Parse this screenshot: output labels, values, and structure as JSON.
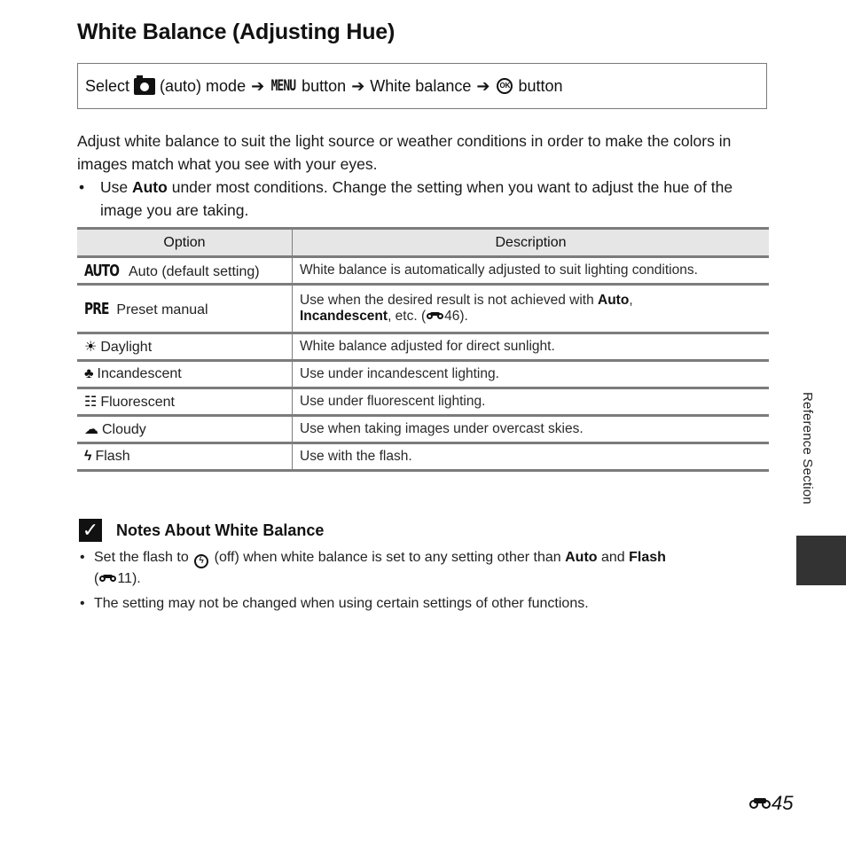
{
  "page": {
    "title": "White Balance (Adjusting Hue)",
    "path": {
      "select": "Select",
      "camera_icon": "camera-icon",
      "mode": "(auto) mode",
      "arrow": "➔",
      "menu": "MENU",
      "button": "button",
      "white_balance": "White balance",
      "ok": "OK",
      "button2": "button"
    },
    "intro": {
      "paragraph": "Adjust white balance to suit the light source or weather conditions in order to make the colors in images match what you see with your eyes.",
      "bullet_pre": "Use ",
      "bullet_bold": "Auto",
      "bullet_post": " under most conditions. Change the setting when you want to adjust the hue of the image you are taking."
    },
    "table": {
      "headers": [
        "Option",
        "Description"
      ],
      "rows": [
        {
          "icon": "AUTO",
          "icon_name": "auto-icon",
          "option": "Auto (default setting)",
          "description": "White balance is automatically adjusted to suit lighting conditions."
        },
        {
          "icon": "PRE",
          "icon_name": "preset-icon",
          "option": "Preset manual",
          "desc_pre": "Use when the desired result is not achieved with ",
          "desc_b1": "Auto",
          "desc_mid": ", ",
          "desc_b2": "Incandescent",
          "desc_post": ", etc. (",
          "desc_ref": "46",
          "desc_end": ")."
        },
        {
          "icon": "☀",
          "icon_name": "daylight-icon",
          "option": "Daylight",
          "description": "White balance adjusted for direct sunlight."
        },
        {
          "icon": "♣",
          "icon_name": "incandescent-icon",
          "option": "Incandescent",
          "description": "Use under incandescent lighting."
        },
        {
          "icon": "☷",
          "icon_name": "fluorescent-icon",
          "option": "Fluorescent",
          "description": "Use under fluorescent lighting."
        },
        {
          "icon": "☁",
          "icon_name": "cloudy-icon",
          "option": "Cloudy",
          "description": "Use when taking images under overcast skies."
        },
        {
          "icon": "ϟ",
          "icon_name": "flash-icon",
          "option": "Flash",
          "description": "Use with the flash."
        }
      ]
    },
    "notes": {
      "title": "Notes About White Balance",
      "check": "✓",
      "item1_pre": "Set the flash to ",
      "item1_icon": "ϟ",
      "item1_mid": " (off) when white balance is set to any setting other than ",
      "item1_b1": "Auto",
      "item1_and": " and ",
      "item1_b2": "Flash",
      "item1_ref_open": "(",
      "item1_ref": "11",
      "item1_ref_close": ").",
      "item2": "The setting may not be changed when using certain settings of other functions."
    },
    "side_label": "Reference Section",
    "page_number": "45",
    "colors": {
      "table_header_bg": "#e6e6e6",
      "border": "#7c7c7c",
      "side_tab": "#333333"
    }
  }
}
